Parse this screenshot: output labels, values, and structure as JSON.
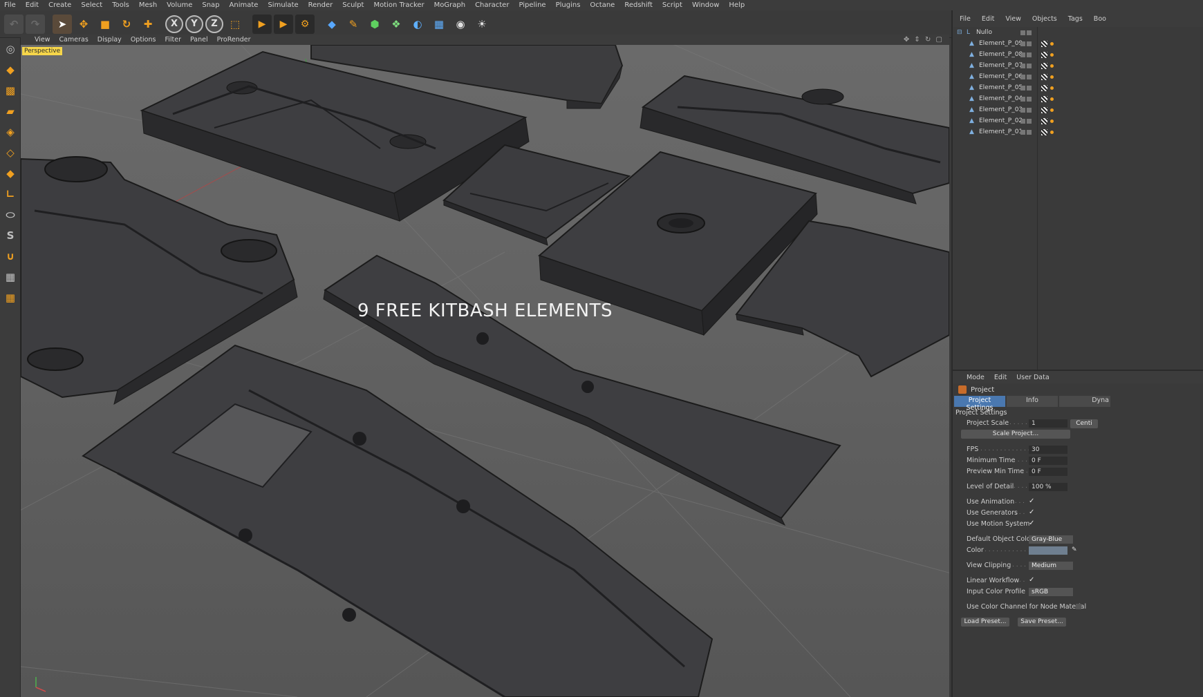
{
  "menubar": {
    "items": [
      "File",
      "Edit",
      "Create",
      "Select",
      "Tools",
      "Mesh",
      "Volume",
      "Snap",
      "Animate",
      "Simulate",
      "Render",
      "Sculpt",
      "Motion Tracker",
      "MoGraph",
      "Character",
      "Pipeline",
      "Plugins",
      "Octane",
      "Redshift",
      "Script",
      "Window",
      "Help"
    ]
  },
  "toolbar": {
    "axis_x": "X",
    "axis_y": "Y",
    "axis_z": "Z"
  },
  "viewport": {
    "menu": [
      "View",
      "Cameras",
      "Display",
      "Options",
      "Filter",
      "Panel",
      "ProRender"
    ],
    "camera_badge": "Perspective",
    "overlay_title": "9 FREE KITBASH ELEMENTS"
  },
  "object_manager": {
    "menu": [
      "File",
      "Edit",
      "View",
      "Objects",
      "Tags",
      "Boo"
    ],
    "root": "Nullo",
    "children": [
      "Element_P_09",
      "Element_P_08",
      "Element_P_07",
      "Element_P_06",
      "Element_P_05",
      "Element_P_04",
      "Element_P_03",
      "Element_P_02",
      "Element_P_01"
    ]
  },
  "attribute_manager": {
    "menu": [
      "Mode",
      "Edit",
      "User Data"
    ],
    "title": "Project",
    "tabs": [
      "Project Settings",
      "Info",
      "Dyna"
    ],
    "section": "Project Settings",
    "project_scale_label": "Project Scale",
    "project_scale_value": "1",
    "project_scale_unit": "Centi",
    "scale_project_button": "Scale Project...",
    "fps_label": "FPS",
    "fps_value": "30",
    "min_time_label": "Minimum Time",
    "min_time_value": "0 F",
    "preview_min_label": "Preview Min Time",
    "preview_min_value": "0 F",
    "lod_label": "Level of Detail",
    "lod_value": "100 %",
    "use_animation_label": "Use Animation",
    "use_generators_label": "Use Generators",
    "use_motion_label": "Use Motion System",
    "default_color_label": "Default Object Color",
    "default_color_value": "Gray-Blue",
    "color_label": "Color",
    "view_clipping_label": "View Clipping",
    "view_clipping_value": "Medium",
    "linear_workflow_label": "Linear Workflow",
    "input_profile_label": "Input Color Profile",
    "input_profile_value": "sRGB",
    "node_material_label": "Use Color Channel for Node Material",
    "load_preset_button": "Load Preset...",
    "save_preset_button": "Save Preset...",
    "checkmark": "✓"
  }
}
